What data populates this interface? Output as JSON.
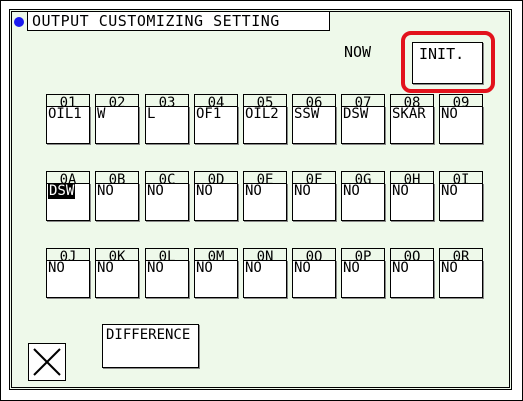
{
  "header": {
    "title": "OUTPUT CUSTOMIZING SETTING",
    "now_label": "NOW",
    "init_label": "INIT."
  },
  "outputs": [
    {
      "code": "01",
      "value": "OIL1"
    },
    {
      "code": "02",
      "value": "W"
    },
    {
      "code": "03",
      "value": "L"
    },
    {
      "code": "04",
      "value": "OF1"
    },
    {
      "code": "05",
      "value": "OIL2"
    },
    {
      "code": "06",
      "value": "SSW"
    },
    {
      "code": "07",
      "value": "DSW"
    },
    {
      "code": "08",
      "value": "SKAR"
    },
    {
      "code": "09",
      "value": "NO"
    },
    {
      "code": "0A",
      "value": "DSW"
    },
    {
      "code": "0B",
      "value": "NO"
    },
    {
      "code": "0C",
      "value": "NO"
    },
    {
      "code": "0D",
      "value": "NO"
    },
    {
      "code": "0E",
      "value": "NO"
    },
    {
      "code": "0F",
      "value": "NO"
    },
    {
      "code": "0G",
      "value": "NO"
    },
    {
      "code": "0H",
      "value": "NO"
    },
    {
      "code": "0I",
      "value": "NO"
    },
    {
      "code": "0J",
      "value": "NO"
    },
    {
      "code": "0K",
      "value": "NO"
    },
    {
      "code": "0L",
      "value": "NO"
    },
    {
      "code": "0M",
      "value": "NO"
    },
    {
      "code": "0N",
      "value": "NO"
    },
    {
      "code": "0O",
      "value": "NO"
    },
    {
      "code": "0P",
      "value": "NO"
    },
    {
      "code": "0Q",
      "value": "NO"
    },
    {
      "code": "0R",
      "value": "NO"
    }
  ],
  "selected_output": "0A",
  "footer": {
    "difference_label": "DIFFERENCE",
    "close_icon": "x-close-icon"
  },
  "colors": {
    "panel_background": "#eef9ea",
    "highlight": "#e2121c",
    "status_dot": "#1a1aee"
  }
}
